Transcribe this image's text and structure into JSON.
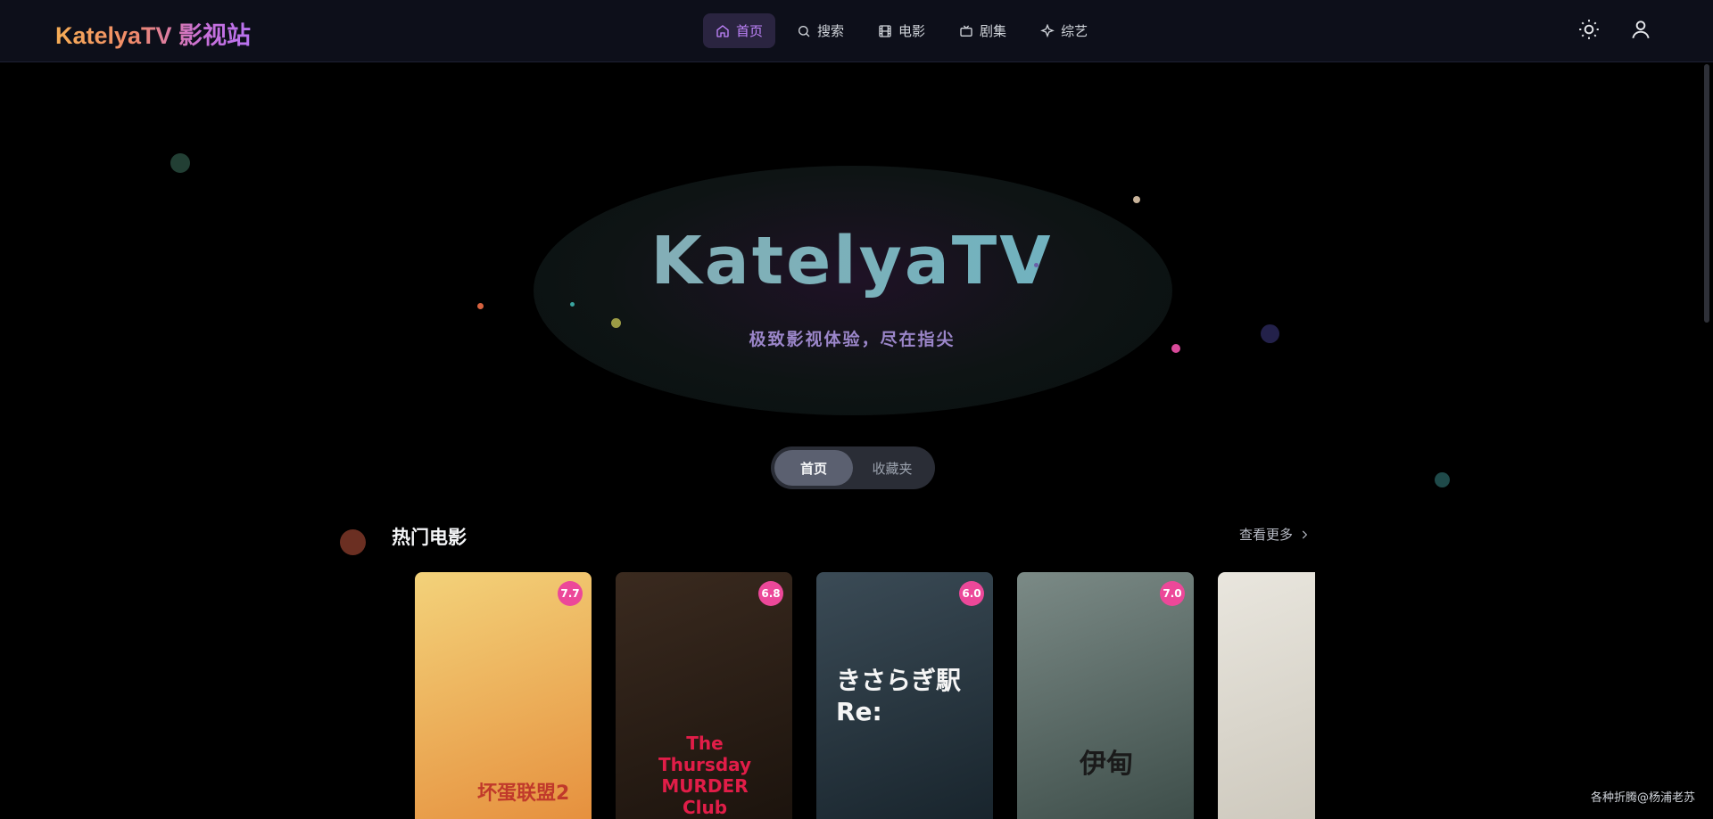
{
  "app": {
    "brand": "KatelyaTV 影视站"
  },
  "nav": [
    {
      "label": "首页",
      "icon": "home-icon",
      "active": true
    },
    {
      "label": "搜索",
      "icon": "search-icon"
    },
    {
      "label": "电影",
      "icon": "film-icon"
    },
    {
      "label": "剧集",
      "icon": "tv-icon"
    },
    {
      "label": "综艺",
      "icon": "sparkle-icon"
    }
  ],
  "top_icons": [
    "theme-toggle-icon",
    "user-icon"
  ],
  "hero": {
    "title": "KatelyaTV",
    "subtitle": "极致影视体验，尽在指尖"
  },
  "segment": {
    "tabs": [
      "首页",
      "收藏夹"
    ],
    "active": "首页"
  },
  "section": {
    "title": "热门电影",
    "more_label": "查看更多"
  },
  "movies": [
    {
      "rating": "7.7",
      "poster_text": "坏蛋联盟2",
      "colors": [
        "#f3d27a",
        "#e58c3a"
      ]
    },
    {
      "rating": "6.8",
      "poster_text": "The Thursday MURDER Club",
      "colors": [
        "#3a2a1f",
        "#1a120c"
      ]
    },
    {
      "rating": "6.0",
      "poster_text": "きさらぎ駅 Re:",
      "colors": [
        "#3b4b56",
        "#16222a"
      ]
    },
    {
      "rating": "7.0",
      "poster_text": "伊甸",
      "colors": [
        "#7b8a86",
        "#3a4a46"
      ]
    },
    {
      "rating": "",
      "poster_text": "",
      "colors": [
        "#e9e6de",
        "#c9c4b8"
      ]
    }
  ],
  "watermark": "各种折腾@杨浦老苏"
}
